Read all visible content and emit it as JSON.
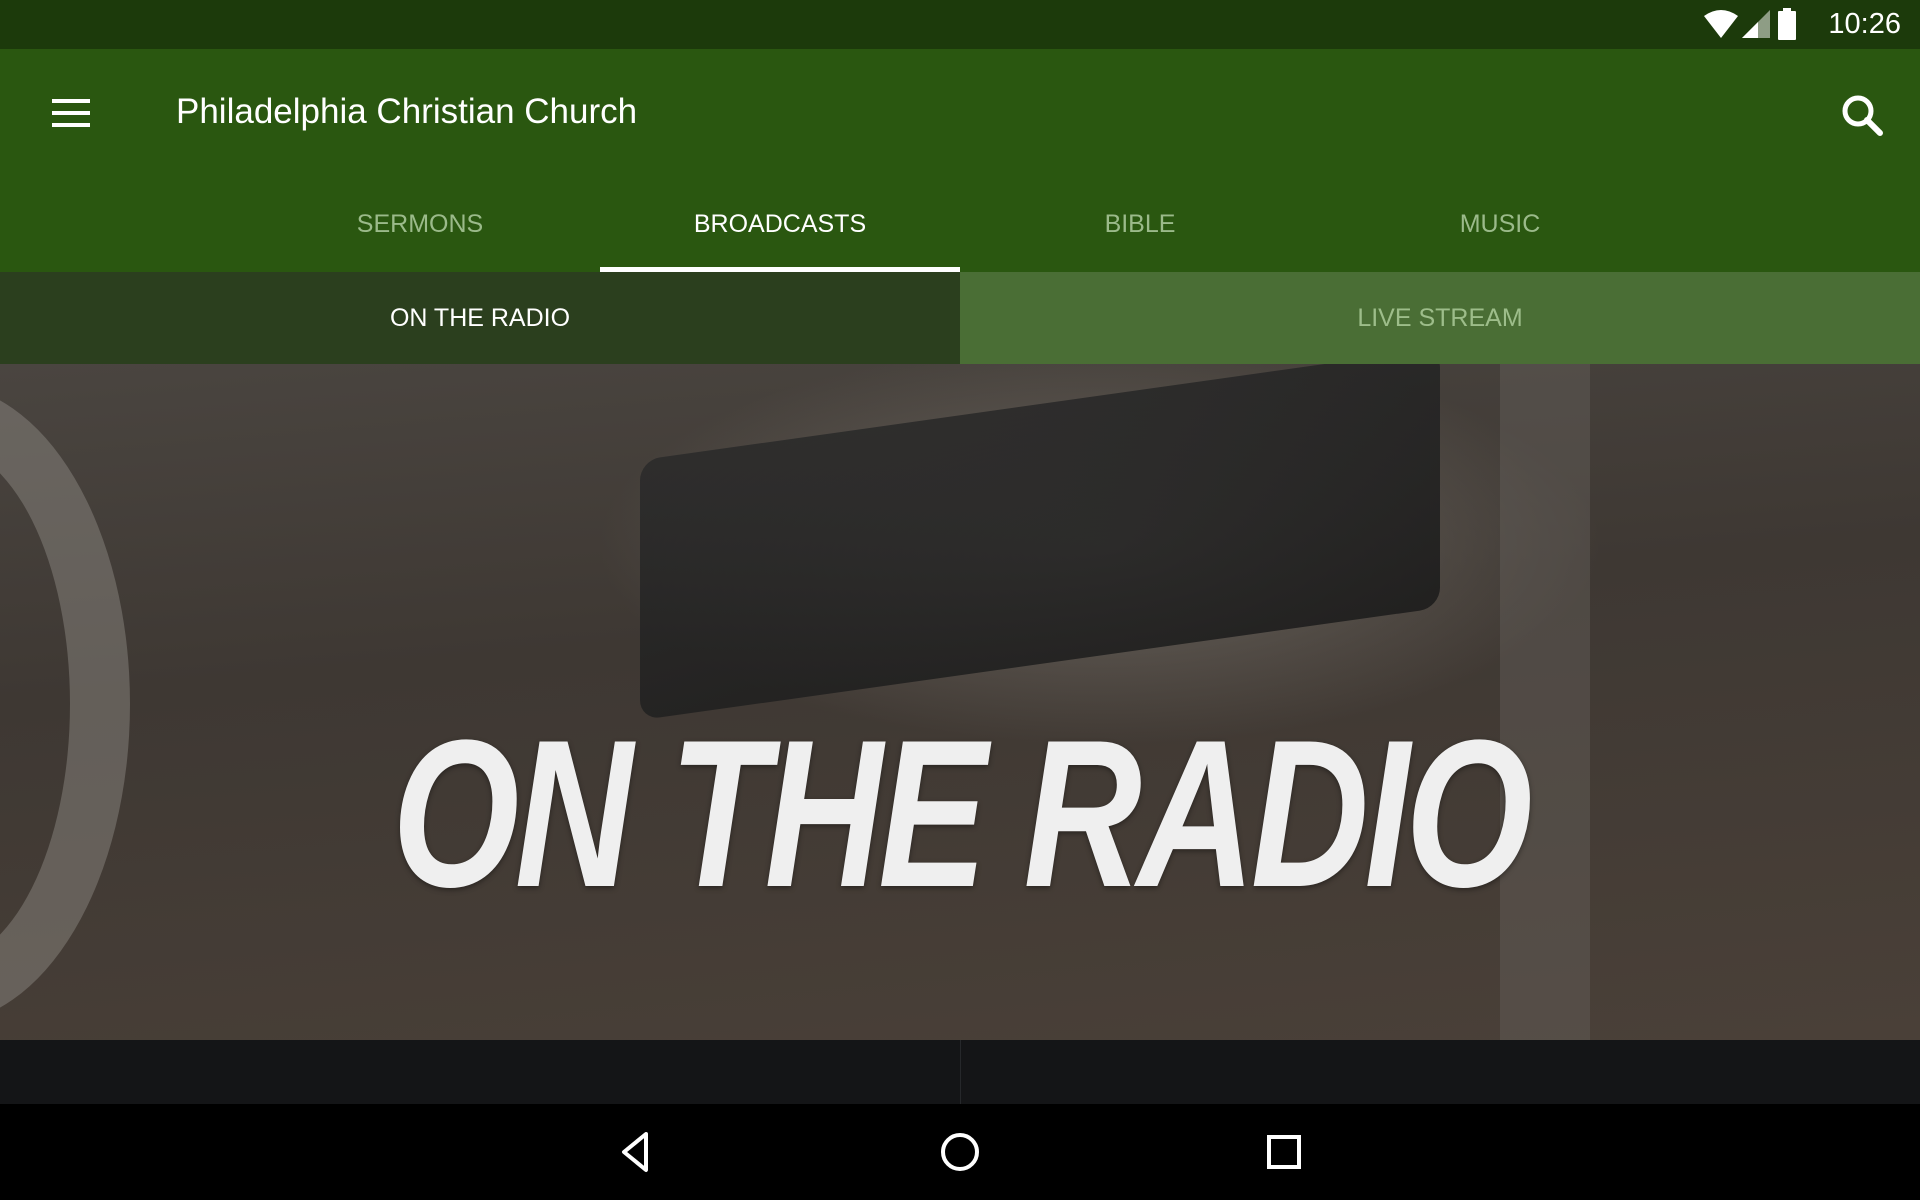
{
  "status_bar": {
    "time": "10:26",
    "icons": [
      "wifi-icon",
      "signal-icon",
      "battery-icon"
    ]
  },
  "app_bar": {
    "title": "Philadelphia Christian Church",
    "menu_icon": "menu-icon",
    "search_icon": "search-icon",
    "color": "#2a5710"
  },
  "tabs": [
    {
      "label": "SERMONS"
    },
    {
      "label": "BROADCASTS",
      "active": true
    },
    {
      "label": "BIBLE"
    },
    {
      "label": "MUSIC"
    }
  ],
  "sub_tabs": [
    {
      "label": "ON THE RADIO",
      "active": true
    },
    {
      "label": "LIVE STREAM"
    }
  ],
  "hero": {
    "text": "ON THE RADIO"
  },
  "nav_bar": {
    "icons": [
      "back-icon",
      "home-icon",
      "recents-icon"
    ]
  }
}
